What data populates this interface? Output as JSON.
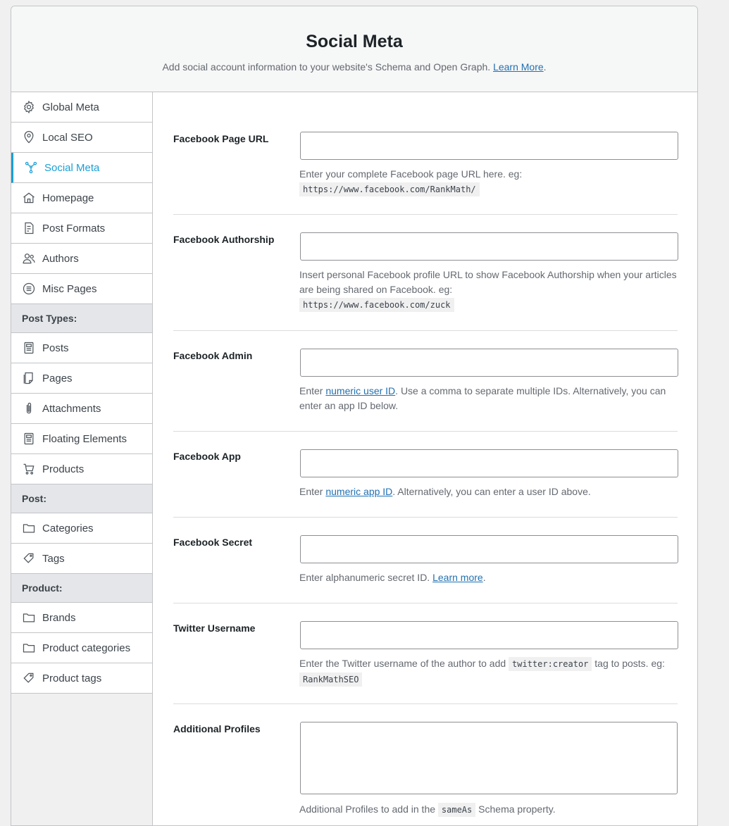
{
  "header": {
    "title": "Social Meta",
    "subtitle": "Add social account information to your website's Schema and Open Graph.",
    "learn_more": "Learn More"
  },
  "sidebar": {
    "items": [
      {
        "label": "Global Meta",
        "icon": "gear-icon"
      },
      {
        "label": "Local SEO",
        "icon": "location-pin-icon"
      },
      {
        "label": "Social Meta",
        "icon": "share-network-icon",
        "active": true
      },
      {
        "label": "Homepage",
        "icon": "home-icon"
      },
      {
        "label": "Post Formats",
        "icon": "document-icon"
      },
      {
        "label": "Authors",
        "icon": "users-icon"
      },
      {
        "label": "Misc Pages",
        "icon": "list-circle-icon"
      }
    ],
    "post_types_heading": "Post Types:",
    "post_types": [
      {
        "label": "Posts",
        "icon": "post-icon"
      },
      {
        "label": "Pages",
        "icon": "page-icon"
      },
      {
        "label": "Attachments",
        "icon": "paperclip-icon"
      },
      {
        "label": "Floating Elements",
        "icon": "post-icon"
      },
      {
        "label": "Products",
        "icon": "cart-icon"
      }
    ],
    "post_heading": "Post:",
    "post": [
      {
        "label": "Categories",
        "icon": "folder-icon"
      },
      {
        "label": "Tags",
        "icon": "tag-icon"
      }
    ],
    "product_heading": "Product:",
    "product": [
      {
        "label": "Brands",
        "icon": "folder-icon"
      },
      {
        "label": "Product categories",
        "icon": "folder-icon"
      },
      {
        "label": "Product tags",
        "icon": "tag-icon"
      }
    ]
  },
  "fields": {
    "facebook_page_url": {
      "label": "Facebook Page URL",
      "value": "",
      "desc": "Enter your complete Facebook page URL here. eg:",
      "code": "https://www.facebook.com/RankMath/"
    },
    "facebook_authorship": {
      "label": "Facebook Authorship",
      "value": "",
      "desc": "Insert personal Facebook profile URL to show Facebook Authorship when your articles are being shared on Facebook. eg:",
      "code": "https://www.facebook.com/zuck"
    },
    "facebook_admin": {
      "label": "Facebook Admin",
      "value": "",
      "desc_pre": "Enter",
      "link": "numeric user ID",
      "desc_post": ". Use a comma to separate multiple IDs. Alternatively, you can enter an app ID below."
    },
    "facebook_app": {
      "label": "Facebook App",
      "value": "",
      "desc_pre": "Enter",
      "link": "numeric app ID",
      "desc_post": ". Alternatively, you can enter a user ID above."
    },
    "facebook_secret": {
      "label": "Facebook Secret",
      "value": "",
      "desc_pre": "Enter alphanumeric secret ID.",
      "link": "Learn more",
      "desc_post": "."
    },
    "twitter_username": {
      "label": "Twitter Username",
      "value": "",
      "desc_pre": "Enter the Twitter username of the author to add",
      "code1": "twitter:creator",
      "desc_mid": "tag to posts. eg:",
      "code2": "RankMathSEO"
    },
    "additional_profiles": {
      "label": "Additional Profiles",
      "value": "",
      "desc_pre": "Additional Profiles to add in the",
      "code": "sameAs",
      "desc_post": "Schema property."
    }
  },
  "colors": {
    "accent": "#1a9fd5",
    "link": "#2271b1"
  }
}
